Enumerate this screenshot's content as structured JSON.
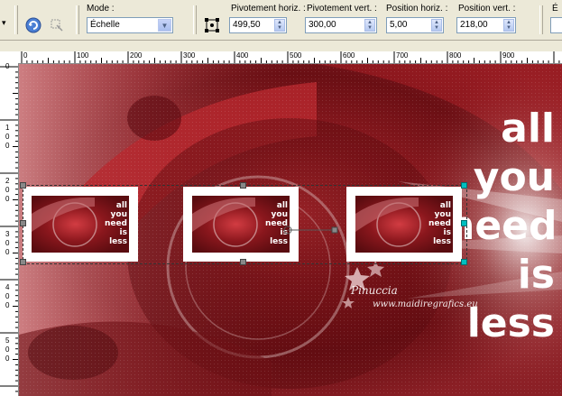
{
  "toolbar": {
    "mode_label": "Mode :",
    "mode_value": "Échelle",
    "pivot_h_label": "Pivotement horiz. :",
    "pivot_h_value": "499,50",
    "pivot_v_label": "Pivotement vert. :",
    "pivot_v_value": "300,00",
    "pos_h_label": "Position horiz. :",
    "pos_h_value": "5,00",
    "pos_v_label": "Position vert. :",
    "pos_v_value": "218,00",
    "cut_label": "É"
  },
  "ruler": {
    "top_labels": [
      "0",
      "100",
      "200",
      "300",
      "400",
      "500",
      "600",
      "700",
      "800",
      "900"
    ],
    "left_labels": [
      "1",
      "0",
      "0",
      "2",
      "0",
      "0",
      "3",
      "0",
      "0",
      "4",
      "0",
      "0",
      "5",
      "0",
      "0"
    ],
    "left_zero": "0"
  },
  "canvas": {
    "text_lines": [
      "all",
      "you",
      "need",
      "is",
      "less"
    ],
    "thumb_text": [
      "all",
      "you",
      "need",
      "is",
      "less"
    ],
    "watermark_name": "Pinuccia",
    "watermark_url": "www.maidiregrafics.eu"
  },
  "colors": {
    "background_red": "#8c1a1f",
    "selection_handle": "#888888",
    "pivot_handle": "#00c0c0"
  }
}
